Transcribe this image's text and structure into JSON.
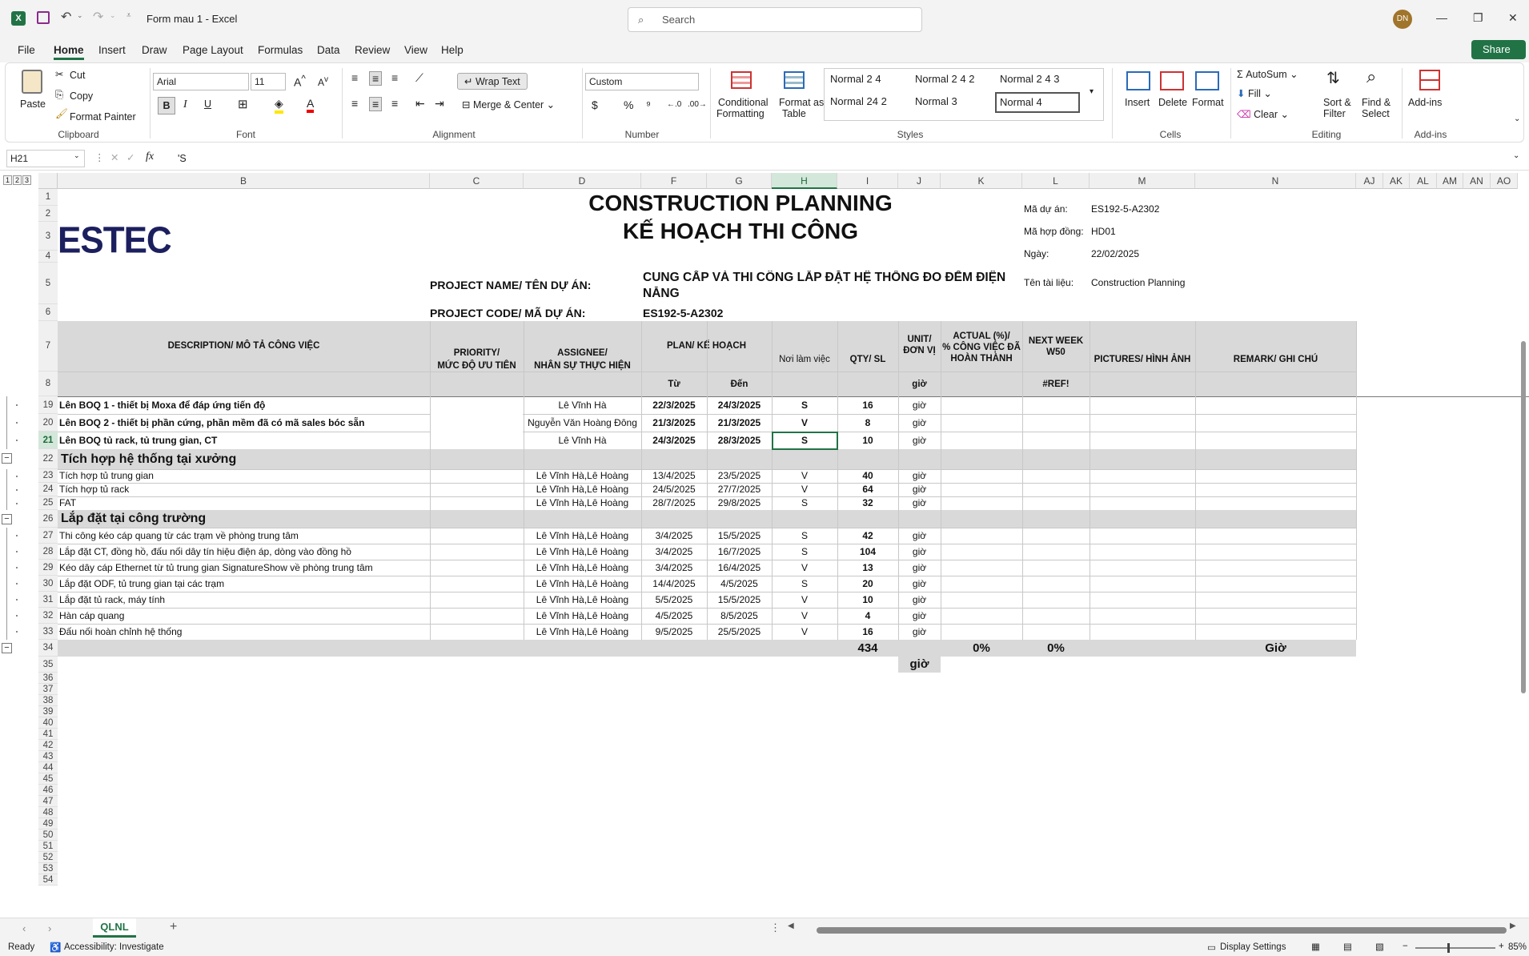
{
  "titlebar": {
    "doc_title": "Form mau 1  -  Excel",
    "search_placeholder": "Search",
    "avatar": "DN"
  },
  "menu": [
    "File",
    "Home",
    "Insert",
    "Draw",
    "Page Layout",
    "Formulas",
    "Data",
    "Review",
    "View",
    "Help"
  ],
  "share_label": "Share",
  "ribbon": {
    "paste": "Paste",
    "cut": "Cut",
    "copy": "Copy",
    "format_painter": "Format Painter",
    "clipboard": "Clipboard",
    "font_name": "Arial",
    "font_size": "11",
    "font_group": "Font",
    "wrap_text": "Wrap Text",
    "merge_center": "Merge & Center",
    "alignment": "Alignment",
    "number_format": "Custom",
    "number": "Number",
    "cond_format_1": "Conditional",
    "cond_format_2": "Formatting",
    "format_table_1": "Format as",
    "format_table_2": "Table",
    "styles": [
      "Normal 2 4",
      "Normal 2 4 2",
      "Normal 2 4 3",
      "Normal 24 2",
      "Normal 3",
      "Normal 4"
    ],
    "styles_group": "Styles",
    "insert": "Insert",
    "delete": "Delete",
    "format": "Format",
    "cells": "Cells",
    "autosum": "AutoSum",
    "fill": "Fill",
    "clear": "Clear",
    "sort_1": "Sort &",
    "sort_2": "Filter",
    "find_1": "Find &",
    "find_2": "Select",
    "editing": "Editing",
    "addins": "Add-ins",
    "addins_group": "Add-ins"
  },
  "formula_bar": {
    "name_box": "H21",
    "fx": "fx",
    "formula": "'S"
  },
  "columns": [
    "B",
    "C",
    "D",
    "F",
    "G",
    "H",
    "I",
    "J",
    "K",
    "L",
    "M",
    "N",
    "AJ",
    "AK",
    "AL",
    "AM",
    "AN",
    "AO"
  ],
  "header": {
    "title_en": "CONSTRUCTION PLANNING",
    "title_vn": "KẾ HOẠCH THI CÔNG",
    "logo": "ESTEC",
    "project_name_label": "PROJECT NAME/ TÊN DỰ ÁN:",
    "project_name_1": "CUNG CẤP VÀ THI CÔNG LẮP ĐẶT HỆ THỐNG ĐO ĐẾM ĐIỆN",
    "project_name_2": "NĂNG",
    "project_code_label": "PROJECT CODE/ MÃ DỰ ÁN:",
    "project_code": "ES192-5-A2302",
    "meta_labels": [
      "Mã dự án:",
      "Mã hợp đồng:",
      "Ngày:",
      "Tên tài liệu:"
    ],
    "meta_values": [
      "ES192-5-A2302",
      "HD01",
      "22/02/2025",
      "Construction Planning"
    ]
  },
  "table_header": {
    "desc": "DESCRIPTION/ MÔ TẢ CÔNG VIỆC",
    "priority_1": "PRIORITY/",
    "priority_2": "MỨC ĐỘ ƯU TIÊN",
    "assignee_1": "ASSIGNEE/",
    "assignee_2": "NHÂN SỰ THỰC HIỆN",
    "plan": "PLAN/ KẾ HOẠCH",
    "from": "Từ",
    "to": "Đến",
    "place": "Nơi làm việc",
    "qty": "QTY/ SL",
    "unit_1": "UNIT/",
    "unit_2": "ĐƠN VỊ",
    "unit_sub": "giờ",
    "actual_1": "ACTUAL (%)/",
    "actual_2": "% CÔNG VIỆC ĐÃ",
    "actual_3": "HOÀN THÀNH",
    "next_1": "NEXT WEEK",
    "next_2": "W50",
    "next_sub": "#REF!",
    "pictures": "PICTURES/ HÌNH ẢNH",
    "remark": "REMARK/ GHI CHÚ"
  },
  "rows": [
    {
      "n": "19",
      "desc": "Lên BOQ 1 - thiết bị Moxa để đáp ứng tiến độ",
      "who": "Lê Vĩnh Hà",
      "from": "22/3/2025",
      "to": "24/3/2025",
      "place": "S",
      "qty": "16",
      "unit": "giờ",
      "bold": true
    },
    {
      "n": "20",
      "desc": "Lên BOQ 2 - thiết bị phần cứng, phần mềm đã có mã sales bóc sẵn",
      "who": "Nguyễn Văn Hoàng Đông",
      "from": "21/3/2025",
      "to": "21/3/2025",
      "place": "V",
      "qty": "8",
      "unit": "giờ",
      "bold": true
    },
    {
      "n": "21",
      "desc": "Lên BOQ tủ rack, tủ trung gian, CT",
      "who": "Lê Vĩnh Hà",
      "from": "24/3/2025",
      "to": "28/3/2025",
      "place": "S",
      "qty": "10",
      "unit": "giờ",
      "bold": true
    },
    {
      "n": "22",
      "section": "Tích hợp hệ thống tại xưởng"
    },
    {
      "n": "23",
      "desc": "Tích hợp tủ trung gian",
      "who": "Lê Vĩnh Hà,Lê Hoàng",
      "from": "13/4/2025",
      "to": "23/5/2025",
      "place": "V",
      "qty": "40",
      "unit": "giờ"
    },
    {
      "n": "24",
      "desc": "Tích hợp tủ rack",
      "who": "Lê Vĩnh Hà,Lê Hoàng",
      "from": "24/5/2025",
      "to": "27/7/2025",
      "place": "V",
      "qty": "64",
      "unit": "giờ"
    },
    {
      "n": "25",
      "desc": "FAT",
      "who": "Lê Vĩnh Hà,Lê Hoàng",
      "from": "28/7/2025",
      "to": "29/8/2025",
      "place": "S",
      "qty": "32",
      "unit": "giờ"
    },
    {
      "n": "26",
      "section": "Lắp đặt tại công trường"
    },
    {
      "n": "27",
      "desc": "Thi công kéo cáp quang từ các trạm về phòng trung tâm",
      "who": "Lê Vĩnh Hà,Lê Hoàng",
      "from": "3/4/2025",
      "to": "15/5/2025",
      "place": "S",
      "qty": "42",
      "unit": "giờ"
    },
    {
      "n": "28",
      "desc": "Lắp đặt CT, đồng hồ, đấu nối dây tín hiệu điện áp, dòng vào đồng hồ",
      "who": "Lê Vĩnh Hà,Lê Hoàng",
      "from": "3/4/2025",
      "to": "16/7/2025",
      "place": "S",
      "qty": "104",
      "unit": "giờ"
    },
    {
      "n": "29",
      "desc": "Kéo dây cáp Ethernet từ tủ trung gian SignatureShow về phòng trung tâm",
      "who": "Lê Vĩnh Hà,Lê Hoàng",
      "from": "3/4/2025",
      "to": "16/4/2025",
      "place": "V",
      "qty": "13",
      "unit": "giờ"
    },
    {
      "n": "30",
      "desc": "Lắp đặt ODF, tủ trung gian tại các trạm",
      "who": "Lê Vĩnh Hà,Lê Hoàng",
      "from": "14/4/2025",
      "to": "4/5/2025",
      "place": "S",
      "qty": "20",
      "unit": "giờ"
    },
    {
      "n": "31",
      "desc": "Lắp đặt tủ rack, máy tính",
      "who": "Lê Vĩnh Hà,Lê Hoàng",
      "from": "5/5/2025",
      "to": "15/5/2025",
      "place": "V",
      "qty": "10",
      "unit": "giờ"
    },
    {
      "n": "32",
      "desc": "Hàn cáp quang",
      "who": "Lê Vĩnh Hà,Lê Hoàng",
      "from": "4/5/2025",
      "to": "8/5/2025",
      "place": "V",
      "qty": "4",
      "unit": "giờ"
    },
    {
      "n": "33",
      "desc": "Đấu nối hoàn chỉnh hệ thống",
      "who": "Lê Vĩnh Hà,Lê Hoàng",
      "from": "9/5/2025",
      "to": "25/5/2025",
      "place": "V",
      "qty": "16",
      "unit": "giờ"
    }
  ],
  "totals": {
    "n": "34",
    "qty": "434",
    "actual": "0%",
    "next": "0%",
    "remark": "Giờ",
    "unit35": "giờ"
  },
  "outline_levels": [
    "1",
    "2",
    "3"
  ],
  "sheet_tab": "QLNL",
  "status": {
    "ready": "Ready",
    "accessibility": "Accessibility: Investigate",
    "display": "Display Settings",
    "zoom": "85%"
  }
}
